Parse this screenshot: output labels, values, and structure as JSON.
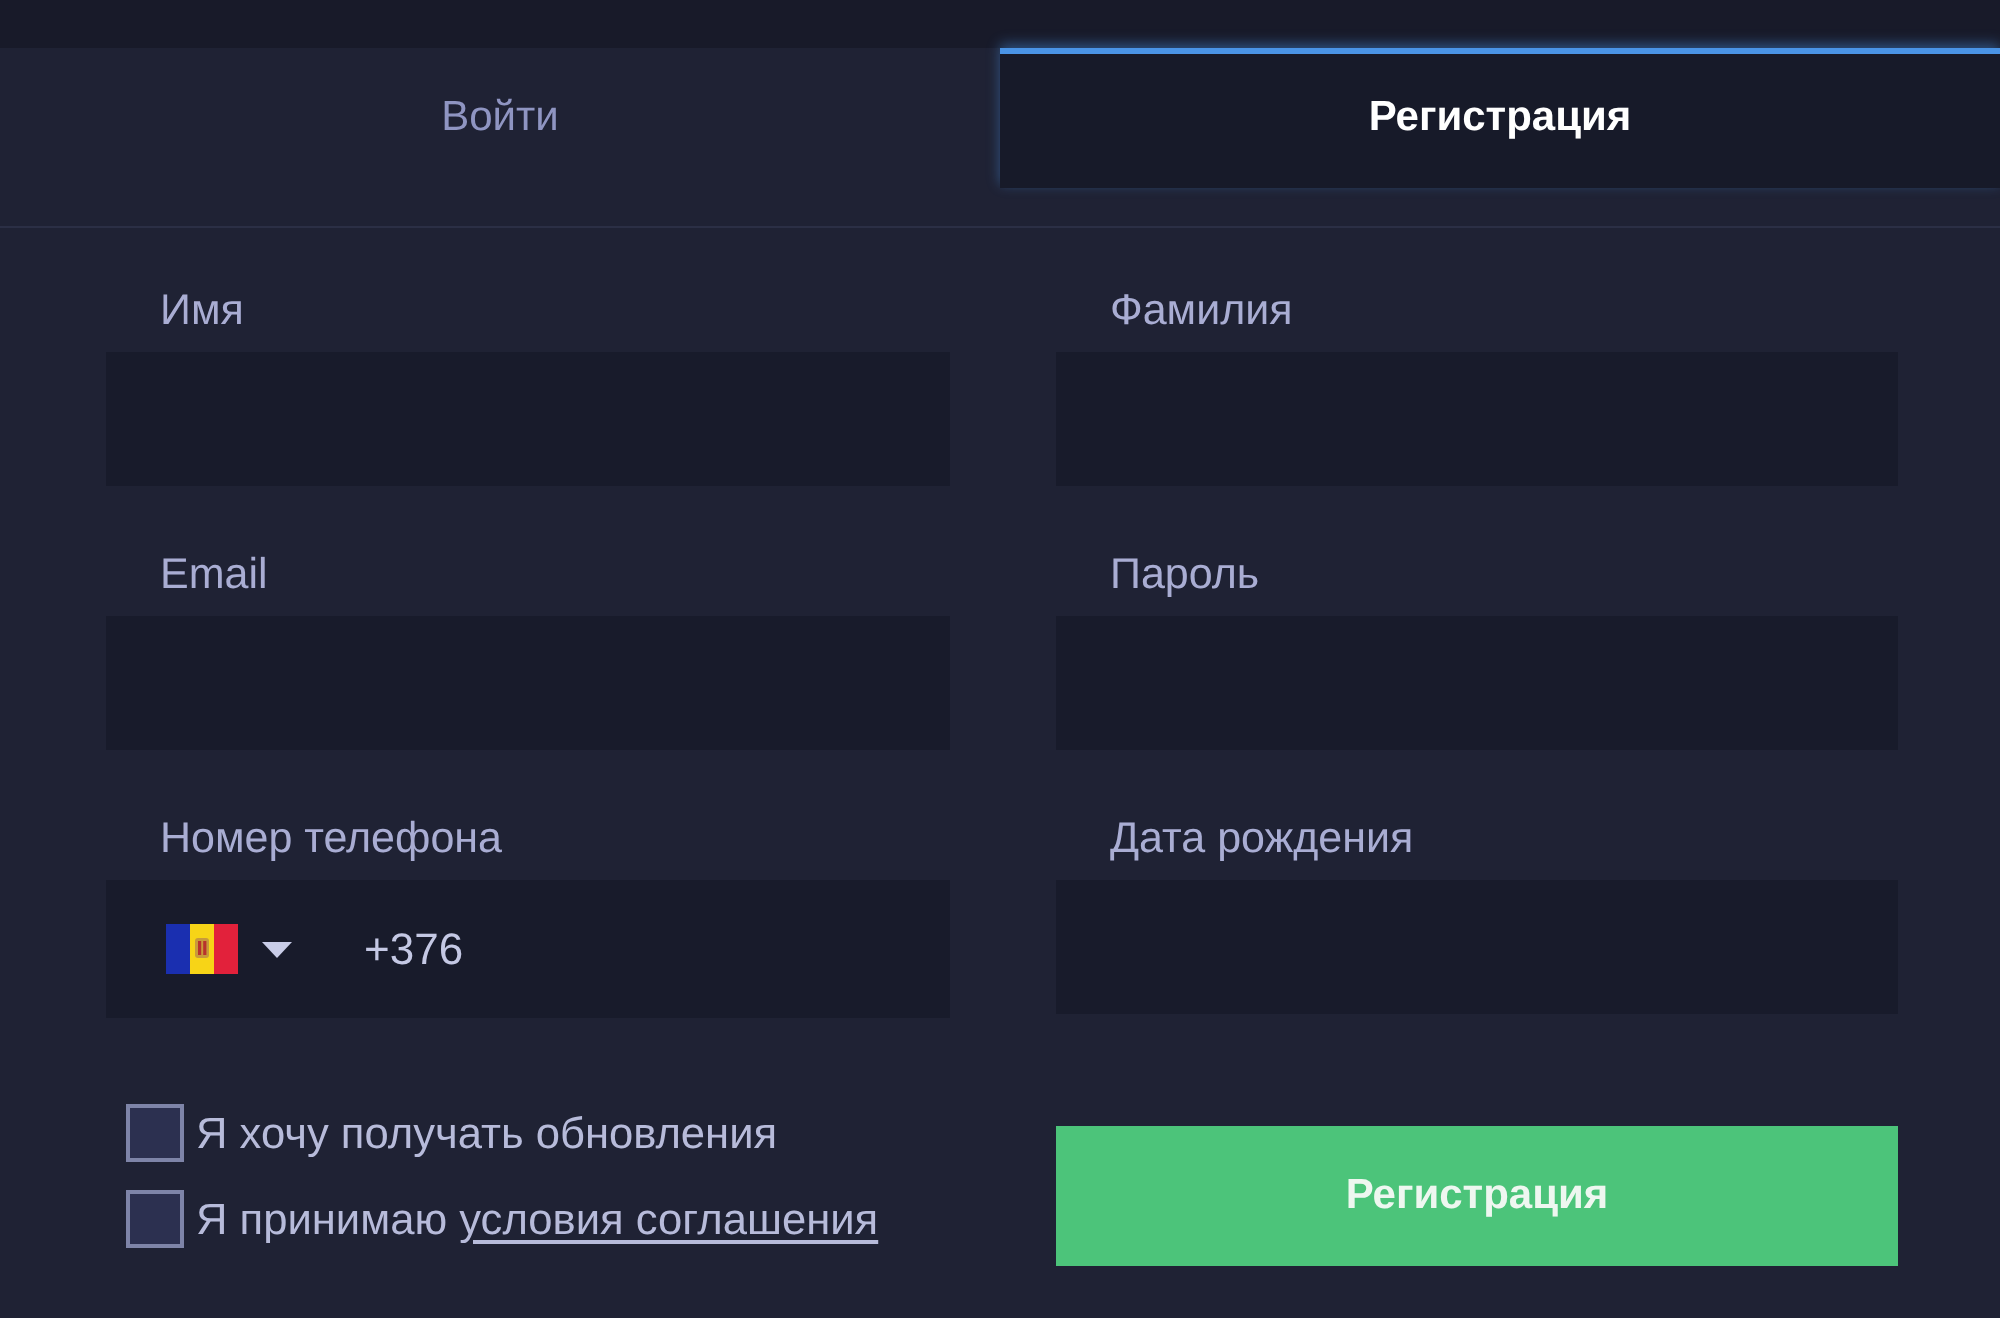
{
  "tabs": [
    {
      "label": "Войти",
      "selected": false
    },
    {
      "label": "Регистрация",
      "selected": true
    }
  ],
  "form": {
    "fields": [
      {
        "label": "Имя",
        "kind": "text"
      },
      {
        "label": "Фамилия",
        "kind": "text"
      },
      {
        "label": "Email",
        "kind": "text"
      },
      {
        "label": "Пароль",
        "kind": "text"
      },
      {
        "label": "Номер телефона",
        "kind": "phone",
        "value": "+376"
      },
      {
        "label": "Дата рождения",
        "kind": "text"
      }
    ],
    "checkboxes": [
      {
        "text": "Я хочу получать обновления",
        "checked": false
      },
      {
        "text": "Я принимаю",
        "link": "условия соглашения",
        "checked": false
      }
    ],
    "submit_button": "Регистрация"
  }
}
